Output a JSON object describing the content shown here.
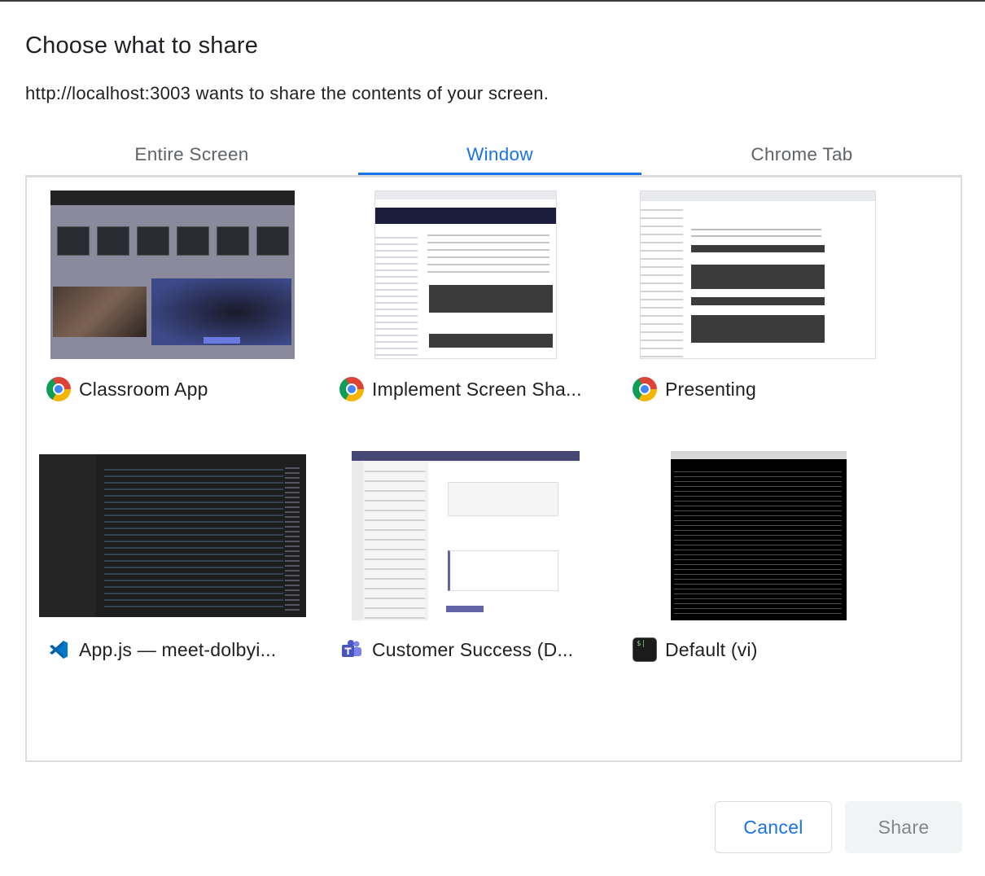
{
  "dialog": {
    "title": "Choose what to share",
    "subtitle": "http://localhost:3003 wants to share the contents of your screen."
  },
  "tabs": [
    {
      "label": "Entire Screen",
      "active": false
    },
    {
      "label": "Window",
      "active": true
    },
    {
      "label": "Chrome Tab",
      "active": false
    }
  ],
  "windows": [
    {
      "label": "Classroom App",
      "icon": "chrome-icon"
    },
    {
      "label": "Implement Screen Sha...",
      "icon": "chrome-icon"
    },
    {
      "label": "Presenting",
      "icon": "chrome-icon"
    },
    {
      "label": "App.js — meet-dolbyi...",
      "icon": "vscode-icon"
    },
    {
      "label": "Customer Success (D...",
      "icon": "teams-icon"
    },
    {
      "label": "Default (vi)",
      "icon": "terminal-icon"
    }
  ],
  "buttons": {
    "cancel": "Cancel",
    "share": "Share"
  },
  "colors": {
    "accent": "#1a73e8",
    "tab_inactive": "#5f6368",
    "share_disabled_bg": "#f1f3f4"
  }
}
